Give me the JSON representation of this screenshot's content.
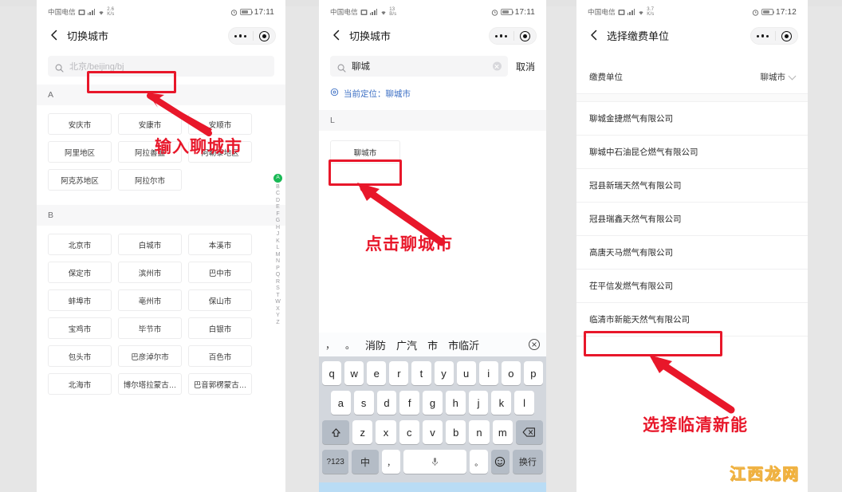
{
  "panel1": {
    "status": {
      "carrier": "中国电信",
      "speed_val": "2.6",
      "speed_unit": "K/s",
      "time": "17:11"
    },
    "nav": {
      "back_icon": "chevron-left-icon",
      "title": "切换城市",
      "more_icon": "more-dots-icon",
      "target_icon": "target-icon"
    },
    "search": {
      "placeholder": "北京/beijing/bj",
      "icon": "search-icon"
    },
    "annotation": {
      "text": "输入聊城市",
      "color": "#e8172a"
    },
    "sections": [
      {
        "letter": "A",
        "cities": [
          "安庆市",
          "安康市",
          "安顺市",
          "阿里地区",
          "阿拉善盟",
          "阿勒泰地区",
          "阿克苏地区",
          "阿拉尔市"
        ]
      },
      {
        "letter": "B",
        "cities": [
          "北京市",
          "白城市",
          "本溪市",
          "保定市",
          "滨州市",
          "巴中市",
          "蚌埠市",
          "亳州市",
          "保山市",
          "宝鸡市",
          "毕节市",
          "白银市",
          "包头市",
          "巴彦淖尔市",
          "百色市",
          "北海市",
          "博尔塔拉蒙古…",
          "巴音郭楞蒙古…"
        ]
      }
    ],
    "index_letters": [
      "A",
      "B",
      "C",
      "D",
      "E",
      "F",
      "G",
      "H",
      "J",
      "K",
      "L",
      "M",
      "N",
      "P",
      "Q",
      "R",
      "S",
      "T",
      "W",
      "X",
      "Y",
      "Z"
    ],
    "index_active": "A"
  },
  "panel2": {
    "status": {
      "carrier": "中国电信",
      "speed_val": "13",
      "speed_unit": "B/s",
      "time": "17:11"
    },
    "nav": {
      "back_icon": "chevron-left-icon",
      "title": "切换城市",
      "more_icon": "more-dots-icon",
      "target_icon": "target-icon"
    },
    "search": {
      "value": "聊城",
      "icon": "search-icon",
      "clear_icon": "clear-circle-icon",
      "cancel_label": "取消"
    },
    "locate": {
      "icon": "location-pin-icon",
      "text": "当前定位：聊城市"
    },
    "section_letter": "L",
    "result": "聊城市",
    "annotation": {
      "text": "点击聊城市",
      "color": "#e8172a"
    },
    "keyboard": {
      "candidates": [
        "，",
        "。",
        "消防",
        "广汽",
        "市",
        "市临沂"
      ],
      "close_icon": "candidate-close-icon",
      "row1": [
        "q",
        "w",
        "e",
        "r",
        "t",
        "y",
        "u",
        "i",
        "o",
        "p"
      ],
      "row2": [
        "a",
        "s",
        "d",
        "f",
        "g",
        "h",
        "j",
        "k",
        "l"
      ],
      "row3_shift": "shift-icon",
      "row3": [
        "z",
        "x",
        "c",
        "v",
        "b",
        "n",
        "m"
      ],
      "row3_backspace": "backspace-icon",
      "row4": {
        "numeric": "?123",
        "lang": "中",
        "comma": "，",
        "space_icon": "microphone-icon",
        "period": "。",
        "emoji_icon": "emoji-smiley-icon",
        "enter": "换行"
      }
    }
  },
  "panel3": {
    "status": {
      "carrier": "中国电信",
      "speed_val": "3.7",
      "speed_unit": "K/s",
      "time": "17:12"
    },
    "nav": {
      "back_icon": "chevron-left-icon",
      "title": "选择缴费单位",
      "more_icon": "more-dots-icon",
      "target_icon": "target-icon"
    },
    "field": {
      "label": "缴费单位",
      "value": "聊城市",
      "chevron_icon": "chevron-down-icon"
    },
    "companies": [
      "聊城金捷燃气有限公司",
      "聊城中石油昆仑燃气有限公司",
      "冠县新瑞天然气有限公司",
      "冠县瑞鑫天然气有限公司",
      "高唐天马燃气有限公司",
      "茌平信发燃气有限公司",
      "临清市新能天然气有限公司"
    ],
    "highlighted_company": "临清市新能天然气有限公司",
    "annotation": {
      "text": "选择临清新能",
      "color": "#e8172a"
    },
    "watermark": "江西龙网"
  }
}
